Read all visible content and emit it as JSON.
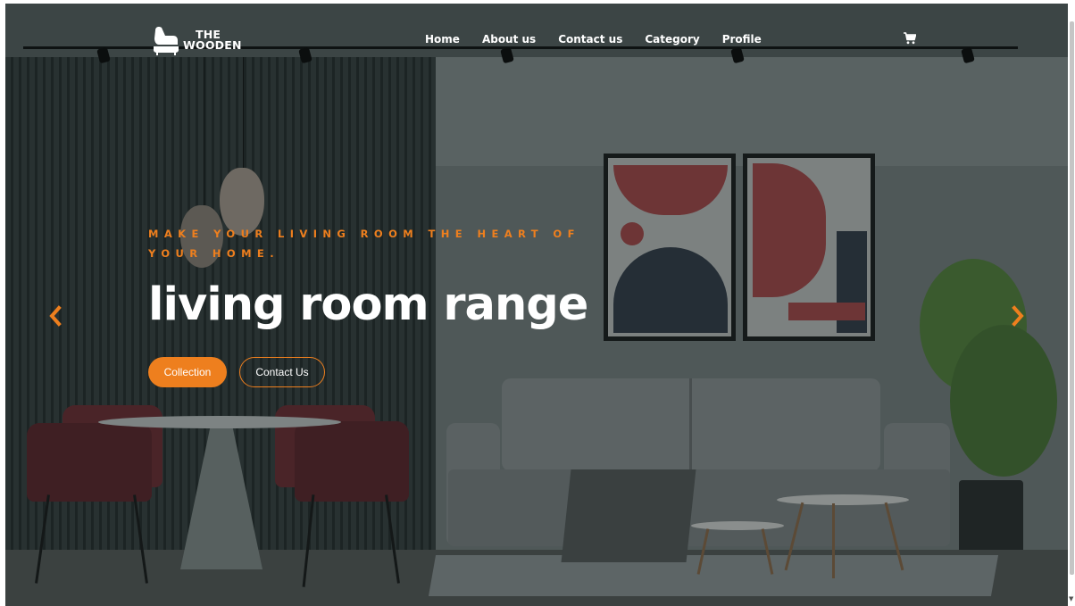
{
  "brand": {
    "line1": "THE",
    "line2": "WOODEN",
    "icon": "armchair-logo-icon"
  },
  "nav": {
    "items": [
      {
        "label": "Home"
      },
      {
        "label": "About us"
      },
      {
        "label": "Contact us"
      },
      {
        "label": "Category"
      },
      {
        "label": "Profile"
      }
    ],
    "cart_icon": "cart-icon"
  },
  "hero": {
    "subtitle": "MAKE YOUR LIVING ROOM THE HEART OF YOUR HOME.",
    "title": "living room range",
    "primary_button": "Collection",
    "secondary_button": "Contact Us",
    "prev_icon": "chevron-left-icon",
    "next_icon": "chevron-right-icon"
  },
  "colors": {
    "accent": "#ee7f1e",
    "text": "#ffffff",
    "overlay": "#2a3333"
  }
}
